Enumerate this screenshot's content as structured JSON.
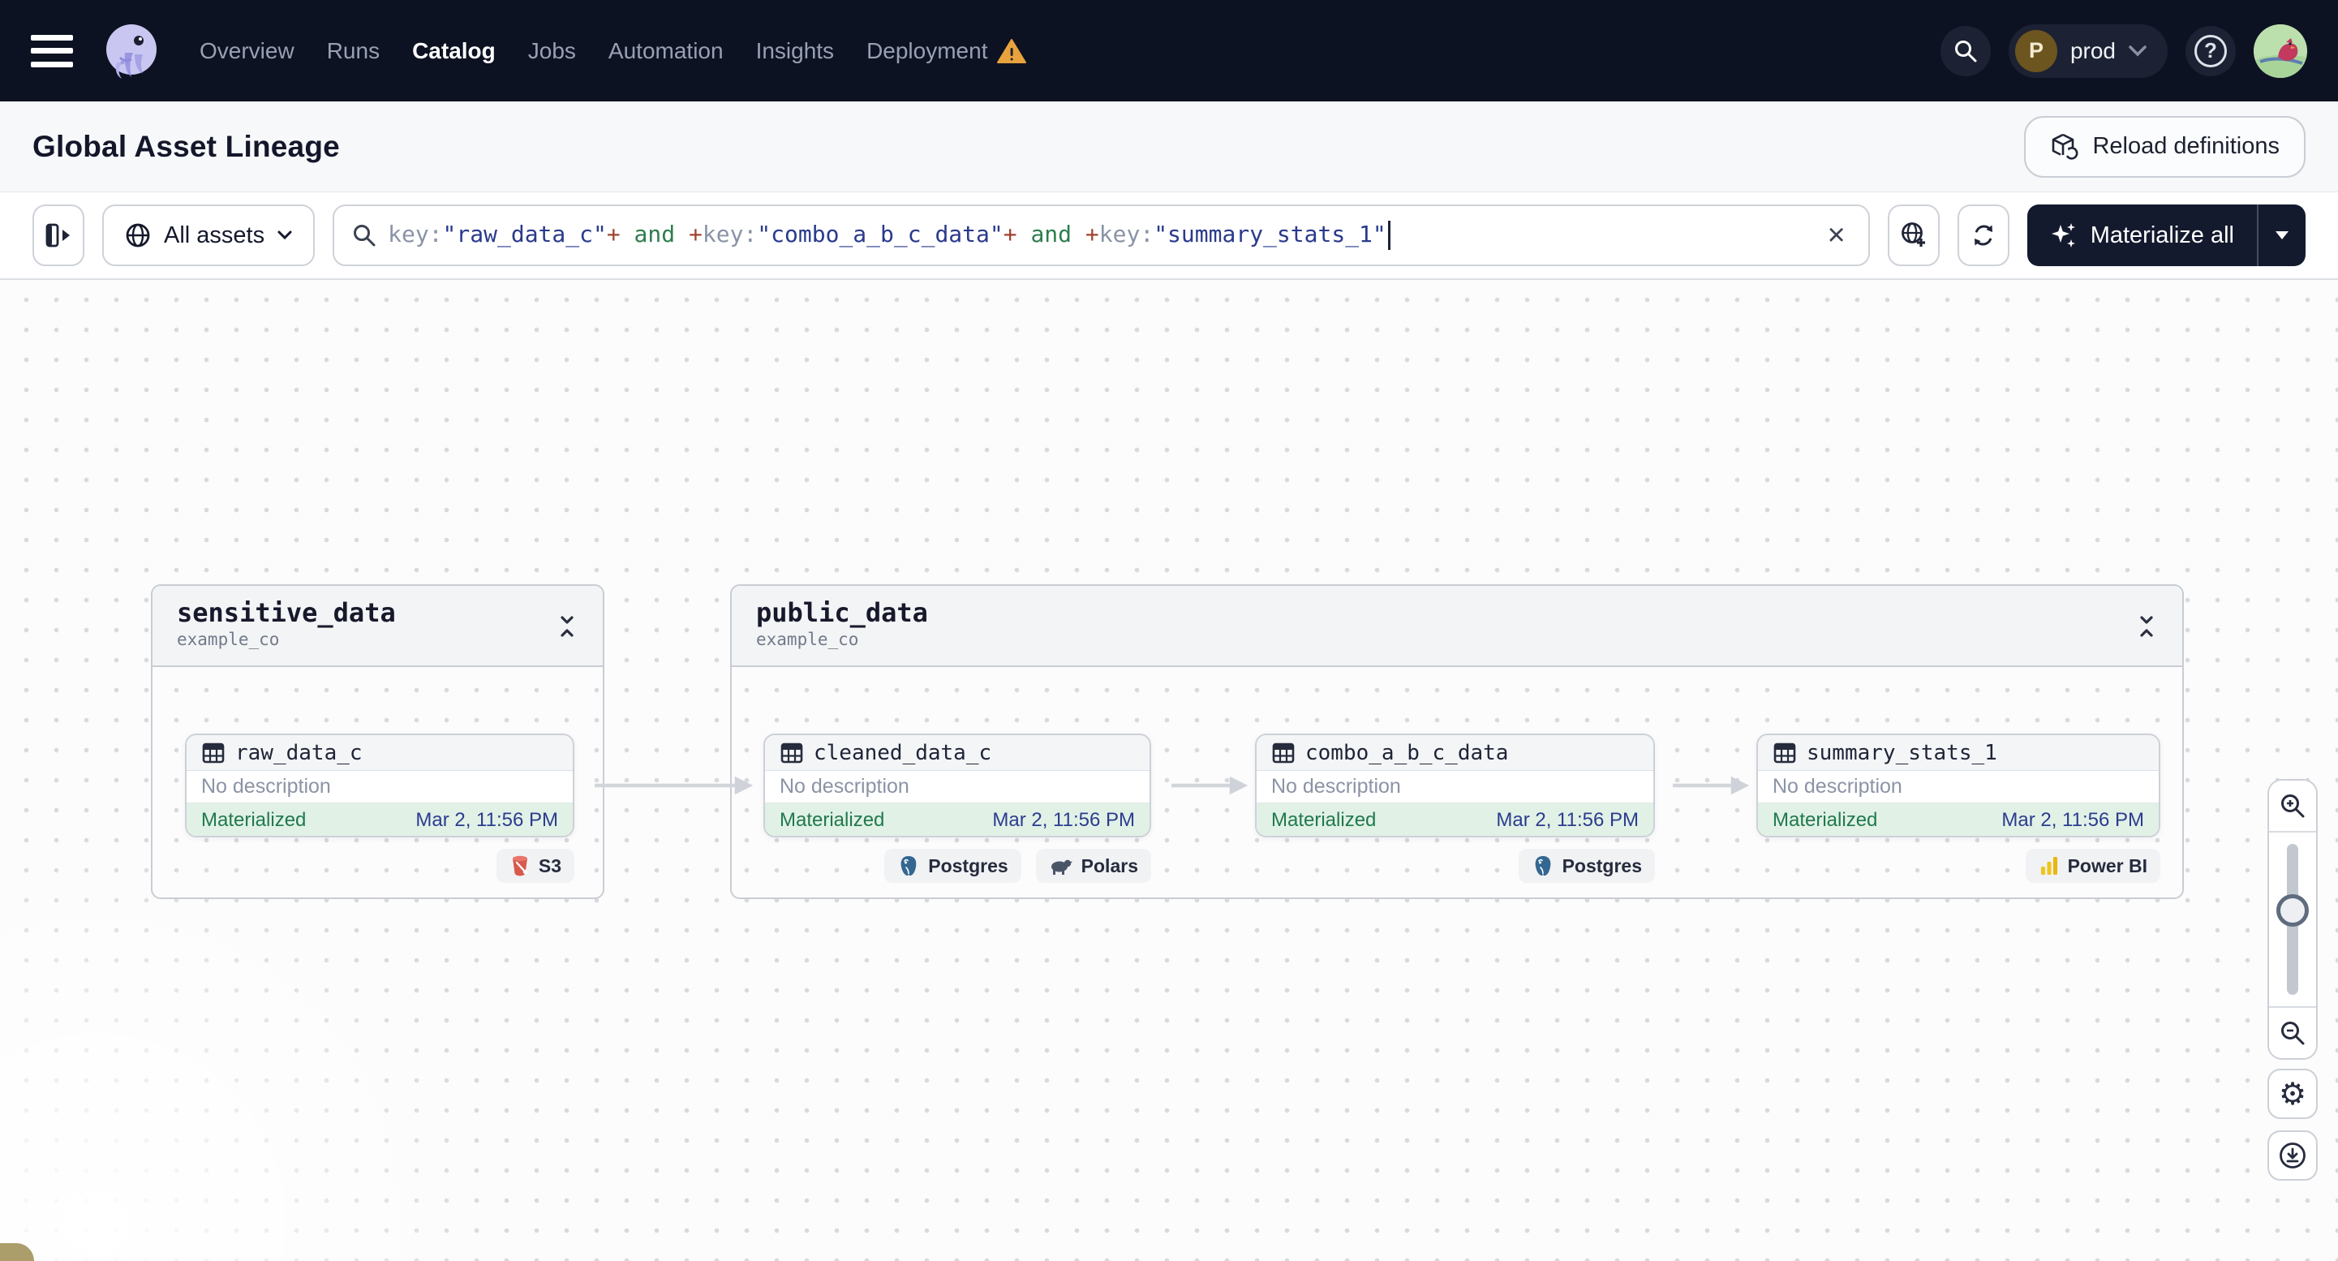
{
  "navbar": {
    "items": [
      {
        "label": "Overview",
        "active": false
      },
      {
        "label": "Runs",
        "active": false
      },
      {
        "label": "Catalog",
        "active": true
      },
      {
        "label": "Jobs",
        "active": false
      },
      {
        "label": "Automation",
        "active": false
      },
      {
        "label": "Insights",
        "active": false
      },
      {
        "label": "Deployment",
        "active": false,
        "warning": true
      }
    ],
    "deployment_switcher": {
      "initial": "P",
      "name": "prod"
    },
    "help_label": "?"
  },
  "header": {
    "title": "Global Asset Lineage",
    "reload_button": "Reload definitions"
  },
  "toolbar": {
    "asset_filter": {
      "label": "All assets"
    },
    "search": {
      "segments": [
        {
          "text": "key:",
          "kind": "field"
        },
        {
          "text": "\"raw_data_c\"",
          "kind": "value"
        },
        {
          "text": "+",
          "kind": "op"
        },
        {
          "text": " and ",
          "kind": "bool"
        },
        {
          "text": "+",
          "kind": "op"
        },
        {
          "text": "key:",
          "kind": "field"
        },
        {
          "text": "\"combo_a_b_c_data\"",
          "kind": "value"
        },
        {
          "text": "+",
          "kind": "op"
        },
        {
          "text": " and ",
          "kind": "bool"
        },
        {
          "text": "+",
          "kind": "op"
        },
        {
          "text": "key:",
          "kind": "field"
        },
        {
          "text": "\"summary_stats_1\"",
          "kind": "value"
        }
      ],
      "clear_label": "×"
    },
    "materialize_button": "Materialize all"
  },
  "graph": {
    "groups": [
      {
        "name": "sensitive_data",
        "location": "example_co",
        "nodes": [
          {
            "name": "raw_data_c",
            "description": "No description",
            "status": "Materialized",
            "materialized_at": "Mar 2, 11:56 PM",
            "tags": [
              {
                "label": "S3",
                "icon": "s3-icon"
              }
            ]
          }
        ]
      },
      {
        "name": "public_data",
        "location": "example_co",
        "nodes": [
          {
            "name": "cleaned_data_c",
            "description": "No description",
            "status": "Materialized",
            "materialized_at": "Mar 2, 11:56 PM",
            "tags": [
              {
                "label": "Postgres",
                "icon": "postgres-icon"
              },
              {
                "label": "Polars",
                "icon": "polars-icon"
              }
            ]
          },
          {
            "name": "combo_a_b_c_data",
            "description": "No description",
            "status": "Materialized",
            "materialized_at": "Mar 2, 11:56 PM",
            "tags": [
              {
                "label": "Postgres",
                "icon": "postgres-icon"
              }
            ]
          },
          {
            "name": "summary_stats_1",
            "description": "No description",
            "status": "Materialized",
            "materialized_at": "Mar 2, 11:56 PM",
            "tags": [
              {
                "label": "Power BI",
                "icon": "powerbi-icon"
              }
            ]
          }
        ]
      }
    ]
  },
  "colors": {
    "navbar_bg": "#0d1222",
    "button_dark": "#141a2e",
    "materialized_green": "#20794d",
    "materialized_bg": "#e1f1e6",
    "timestamp_blue": "#2c3c8e",
    "warning_orange": "#e8a33d",
    "query_field": "#8a93a6",
    "query_value": "#2a3a8c",
    "query_op": "#a0432f",
    "query_bool": "#2e7d4f",
    "edge_gray": "#d2d6db"
  }
}
